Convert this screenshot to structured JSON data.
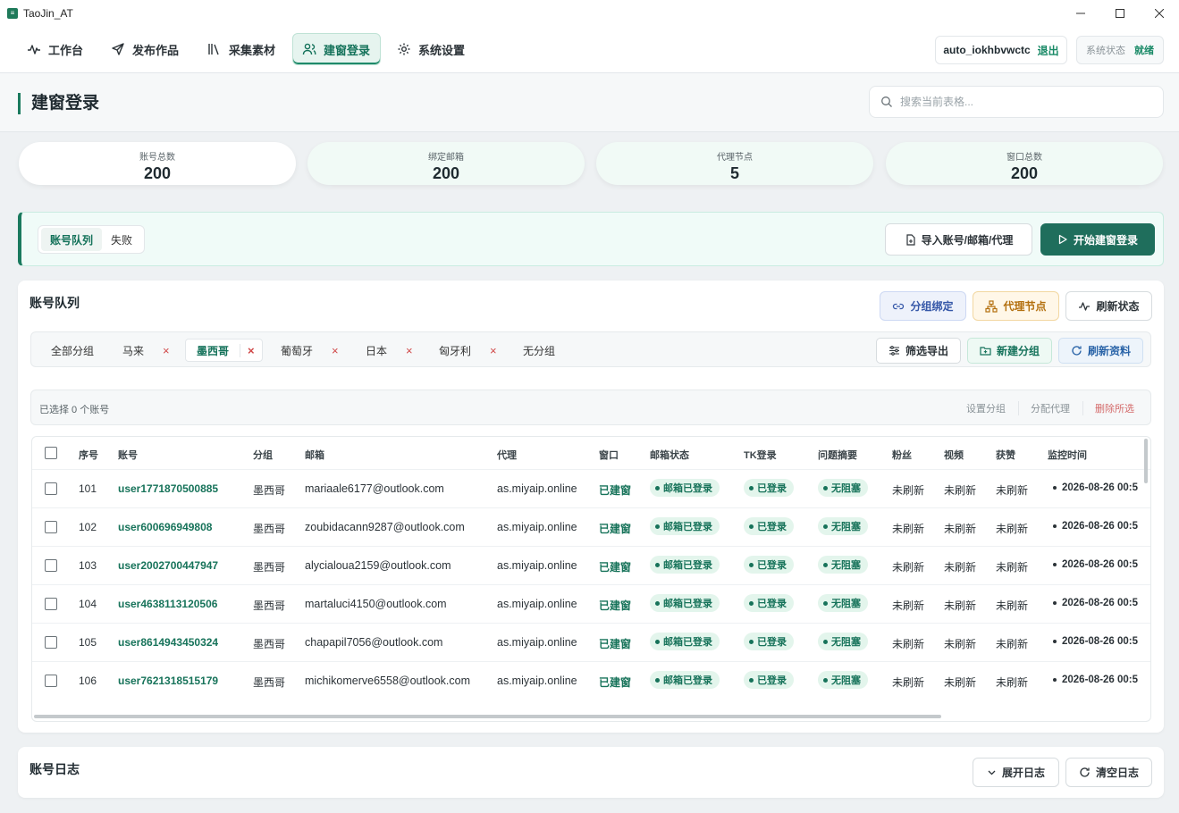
{
  "window": {
    "title": "TaoJin_AT",
    "minimize": "—",
    "maximize": "☐",
    "close": "✕"
  },
  "nav": {
    "items": [
      {
        "label": "工作台",
        "icon": "activity-icon"
      },
      {
        "label": "发布作品",
        "icon": "send-icon"
      },
      {
        "label": "采集素材",
        "icon": "library-icon"
      },
      {
        "label": "建窗登录",
        "icon": "users-icon",
        "active": true
      },
      {
        "label": "系统设置",
        "icon": "gear-icon"
      }
    ],
    "user": "auto_iokhbvwctc",
    "logout": "退出",
    "status_label": "系统状态",
    "status_value": "就绪"
  },
  "page": {
    "title": "建窗登录",
    "search_placeholder": "搜索当前表格..."
  },
  "stats": [
    {
      "label": "账号总数",
      "value": "200"
    },
    {
      "label": "绑定邮箱",
      "value": "200"
    },
    {
      "label": "代理节点",
      "value": "5"
    },
    {
      "label": "窗口总数",
      "value": "200"
    }
  ],
  "actionbar": {
    "tabs": [
      {
        "label": "账号队列",
        "active": true
      },
      {
        "label": "失败"
      }
    ],
    "import_label": "导入账号/邮箱/代理",
    "start_label": "开始建窗登录"
  },
  "queue": {
    "title": "账号队列",
    "group_bind": "分组绑定",
    "proxy_nodes": "代理节点",
    "refresh_status": "刷新状态",
    "groups": [
      "全部分组",
      "马来",
      "墨西哥",
      "葡萄牙",
      "日本",
      "匈牙利",
      "无分组"
    ],
    "active_group": "墨西哥",
    "remove_mark": "×",
    "filter_export": "筛选导出",
    "new_group": "新建分组",
    "refresh_info": "刷新资料",
    "selected_text": "已选择 0 个账号",
    "set_group": "设置分组",
    "assign_proxy": "分配代理",
    "delete_selected": "删除所选"
  },
  "table": {
    "columns": [
      "序号",
      "账号",
      "分组",
      "邮箱",
      "代理",
      "窗口",
      "邮箱状态",
      "TK登录",
      "问题摘要",
      "粉丝",
      "视频",
      "获赞",
      "监控时间"
    ],
    "rows": [
      {
        "no": "101",
        "account": "user1771870500885",
        "group": "墨西哥",
        "email": "mariaale6177@outlook.com",
        "proxy": "as.miyaip.online",
        "window": "已建窗",
        "mail_status": "邮箱已登录",
        "tk_login": "已登录",
        "issue": "无阻塞",
        "fans": "未刷新",
        "videos": "未刷新",
        "likes": "未刷新",
        "time": "2026-08-26 00:5"
      },
      {
        "no": "102",
        "account": "user600696949808",
        "group": "墨西哥",
        "email": "zoubidacann9287@outlook.com",
        "proxy": "as.miyaip.online",
        "window": "已建窗",
        "mail_status": "邮箱已登录",
        "tk_login": "已登录",
        "issue": "无阻塞",
        "fans": "未刷新",
        "videos": "未刷新",
        "likes": "未刷新",
        "time": "2026-08-26 00:5"
      },
      {
        "no": "103",
        "account": "user2002700447947",
        "group": "墨西哥",
        "email": "alycialoua2159@outlook.com",
        "proxy": "as.miyaip.online",
        "window": "已建窗",
        "mail_status": "邮箱已登录",
        "tk_login": "已登录",
        "issue": "无阻塞",
        "fans": "未刷新",
        "videos": "未刷新",
        "likes": "未刷新",
        "time": "2026-08-26 00:5"
      },
      {
        "no": "104",
        "account": "user4638113120506",
        "group": "墨西哥",
        "email": "martaluci4150@outlook.com",
        "proxy": "as.miyaip.online",
        "window": "已建窗",
        "mail_status": "邮箱已登录",
        "tk_login": "已登录",
        "issue": "无阻塞",
        "fans": "未刷新",
        "videos": "未刷新",
        "likes": "未刷新",
        "time": "2026-08-26 00:5"
      },
      {
        "no": "105",
        "account": "user8614943450324",
        "group": "墨西哥",
        "email": "chapapil7056@outlook.com",
        "proxy": "as.miyaip.online",
        "window": "已建窗",
        "mail_status": "邮箱已登录",
        "tk_login": "已登录",
        "issue": "无阻塞",
        "fans": "未刷新",
        "videos": "未刷新",
        "likes": "未刷新",
        "time": "2026-08-26 00:5"
      },
      {
        "no": "106",
        "account": "user7621318515179",
        "group": "墨西哥",
        "email": "michikomerve6558@outlook.com",
        "proxy": "as.miyaip.online",
        "window": "已建窗",
        "mail_status": "邮箱已登录",
        "tk_login": "已登录",
        "issue": "无阻塞",
        "fans": "未刷新",
        "videos": "未刷新",
        "likes": "未刷新",
        "time": "2026-08-26 00:5"
      }
    ]
  },
  "log": {
    "title": "账号日志",
    "expand": "展开日志",
    "clear": "清空日志"
  },
  "colors": {
    "accent": "#1f6e5c",
    "badge_bg": "#e3f5ec",
    "danger": "#d04848"
  }
}
